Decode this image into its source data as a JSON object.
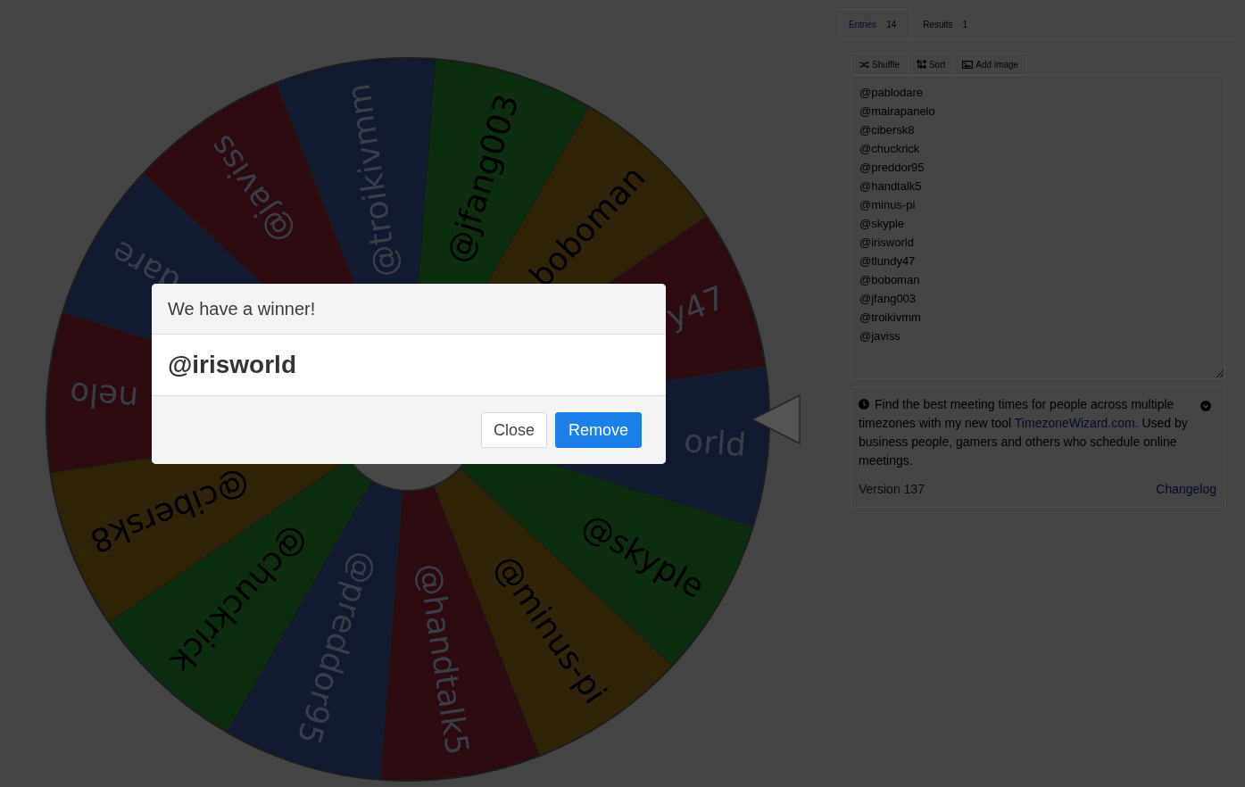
{
  "wheel": {
    "segments": [
      {
        "label": "dare",
        "color": "#121a30"
      },
      {
        "label": "nelo",
        "color": "#2b0b10"
      },
      {
        "label": "@cibersk8",
        "color": "#2f2408"
      },
      {
        "label": "@chuckrick",
        "color": "#0d2d11"
      },
      {
        "label": "@preddor95",
        "color": "#121a30"
      },
      {
        "label": "@handtalk5",
        "color": "#2b0b10"
      },
      {
        "label": "@minus-pi",
        "color": "#2f2408"
      },
      {
        "label": "@skyple",
        "color": "#0d2d11"
      },
      {
        "label": "orld",
        "color": "#121a30"
      },
      {
        "label": "y47",
        "color": "#2b0b10"
      },
      {
        "label": "boboman",
        "color": "#2f2408"
      },
      {
        "label": "@jfang003",
        "color": "#0d2d11"
      },
      {
        "label": "@troikivmm",
        "color": "#121a30"
      },
      {
        "label": "@javiss",
        "color": "#2b0b10"
      }
    ]
  },
  "tabs": [
    {
      "label": "Entries",
      "count": "14",
      "selected": true
    },
    {
      "label": "Results",
      "count": "1",
      "selected": false
    }
  ],
  "toolbar": [
    {
      "label": "Shuffle",
      "kind": "shuffle"
    },
    {
      "label": "Sort",
      "kind": "sort"
    },
    {
      "label": "Add image",
      "kind": "image"
    }
  ],
  "entries": [
    "@pablodare",
    "@mairapanelo",
    "@cibersk8",
    "@chuckrick",
    "@preddor95",
    "@handtalk5",
    "@minus-pi",
    "@skyple",
    "@irisworld",
    "@tlundy47",
    "@boboman",
    "@jfang003",
    "@troikivmm",
    "@javiss"
  ],
  "notice": {
    "text_before": "Find the best meeting times for people across multiple timezones with my new tool ",
    "link": "TimezoneWizard.com",
    "text_after": ". Used by business people, gamers and others who schedule online meetings.",
    "version": "Version 137",
    "changelog": "Changelog"
  },
  "dialog": {
    "title": "We have a winner!",
    "winner": "@irisworld",
    "buttons": [
      {
        "label": "Close",
        "kind": "secondary"
      },
      {
        "label": "Remove",
        "kind": "primary"
      }
    ]
  }
}
